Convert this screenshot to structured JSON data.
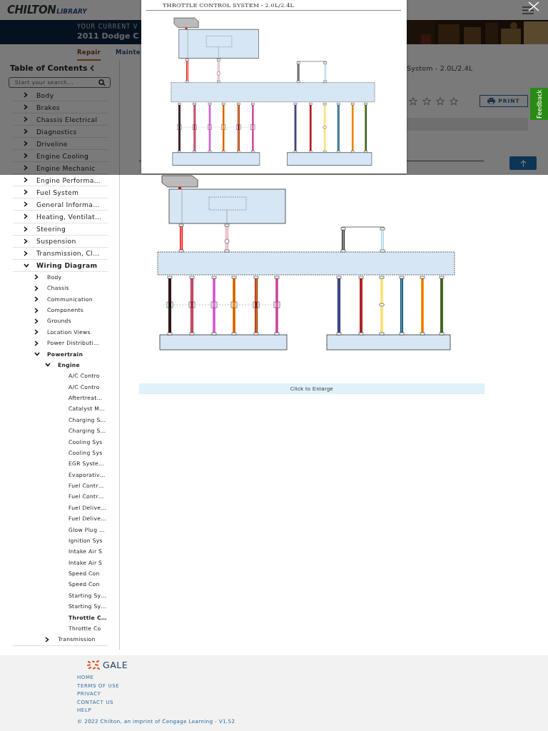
{
  "header": {
    "logo_main": "CHILTON",
    "logo_sub": "LIBRARY"
  },
  "banner": {
    "caption": "YOUR CURRENT V",
    "vehicle": "2011 Dodge C"
  },
  "nav_tabs": [
    {
      "label": "Repair",
      "selected": true
    },
    {
      "label": "Mainte",
      "selected": false
    }
  ],
  "toc": {
    "title": "Table of Contents",
    "search": {
      "placeholder": "Start your search..."
    },
    "items": [
      {
        "label": "Body",
        "expanded": false
      },
      {
        "label": "Brakes",
        "expanded": false
      },
      {
        "label": "Chassis Electrical",
        "expanded": false
      },
      {
        "label": "Diagnostics",
        "expanded": false
      },
      {
        "label": "Driveline",
        "expanded": false
      },
      {
        "label": "Engine Cooling",
        "expanded": false
      },
      {
        "label": "Engine Mechanic",
        "expanded": false
      },
      {
        "label": "Engine Performa…",
        "expanded": false
      },
      {
        "label": "Fuel System",
        "expanded": false
      },
      {
        "label": "General Informa…",
        "expanded": false
      },
      {
        "label": "Heating, Ventilat…",
        "expanded": false
      },
      {
        "label": "Steering",
        "expanded": false
      },
      {
        "label": "Suspension",
        "expanded": false
      },
      {
        "label": "Transmission, Cl…",
        "expanded": false
      },
      {
        "label": "Wiring Diagram",
        "expanded": true,
        "children": [
          {
            "label": "Body",
            "expanded": false
          },
          {
            "label": "Chassis",
            "expanded": false
          },
          {
            "label": "Communication",
            "expanded": false
          },
          {
            "label": "Components",
            "expanded": false
          },
          {
            "label": "Grounds",
            "expanded": false
          },
          {
            "label": "Location Views",
            "expanded": false
          },
          {
            "label": "Power Distributi…",
            "expanded": false
          },
          {
            "label": "Powertrain",
            "expanded": true,
            "children": [
              {
                "label": "Engine",
                "expanded": true,
                "children": [
                  {
                    "label": "A/C Contro",
                    "selected": false
                  },
                  {
                    "label": "A/C Contro",
                    "selected": false
                  },
                  {
                    "label": "Aftertreat…",
                    "selected": false
                  },
                  {
                    "label": "Catalyst M…",
                    "selected": false
                  },
                  {
                    "label": "Charging S…",
                    "selected": false
                  },
                  {
                    "label": "Charging S…",
                    "selected": false
                  },
                  {
                    "label": "Cooling Sys",
                    "selected": false
                  },
                  {
                    "label": "Cooling Sys",
                    "selected": false
                  },
                  {
                    "label": "EGR Syste…",
                    "selected": false
                  },
                  {
                    "label": "Evaporativ…",
                    "selected": false
                  },
                  {
                    "label": "Fuel Contr…",
                    "selected": false
                  },
                  {
                    "label": "Fuel Contr…",
                    "selected": false
                  },
                  {
                    "label": "Fuel Delive…",
                    "selected": false
                  },
                  {
                    "label": "Fuel Delive…",
                    "selected": false
                  },
                  {
                    "label": "Glow Plug …",
                    "selected": false
                  },
                  {
                    "label": "Ignition Sys",
                    "selected": false
                  },
                  {
                    "label": "Intake Air S",
                    "selected": false
                  },
                  {
                    "label": "Intake Air S",
                    "selected": false
                  },
                  {
                    "label": "Speed Con",
                    "selected": false
                  },
                  {
                    "label": "Speed Con",
                    "selected": false
                  },
                  {
                    "label": "Starting Sy…",
                    "selected": false
                  },
                  {
                    "label": "Starting Sy…",
                    "selected": false
                  },
                  {
                    "label": "Throttle C…",
                    "selected": true
                  },
                  {
                    "label": "Throttle Co",
                    "selected": false
                  }
                ]
              },
              {
                "label": "Transmission",
                "expanded": false
              }
            ]
          }
        ]
      }
    ]
  },
  "article": {
    "title": "System - 2.0L/2.4L",
    "rating": {
      "stars": 0
    },
    "print_button": "PRINT",
    "enlarge": "Click to Enlarge"
  },
  "feedback_tab": "Feedback",
  "modal": {
    "title": "THROTTLE CONTROL SYSTEM - 2.0L/2.4L"
  },
  "footer": {
    "logo": "GALE",
    "links": [
      "HOME",
      "TERMS OF USE",
      "PRIVACY",
      "CONTACT US",
      "HELP"
    ],
    "copyright": "© 2022 Chilton, an imprint of Cengage Learning - V1.52"
  }
}
